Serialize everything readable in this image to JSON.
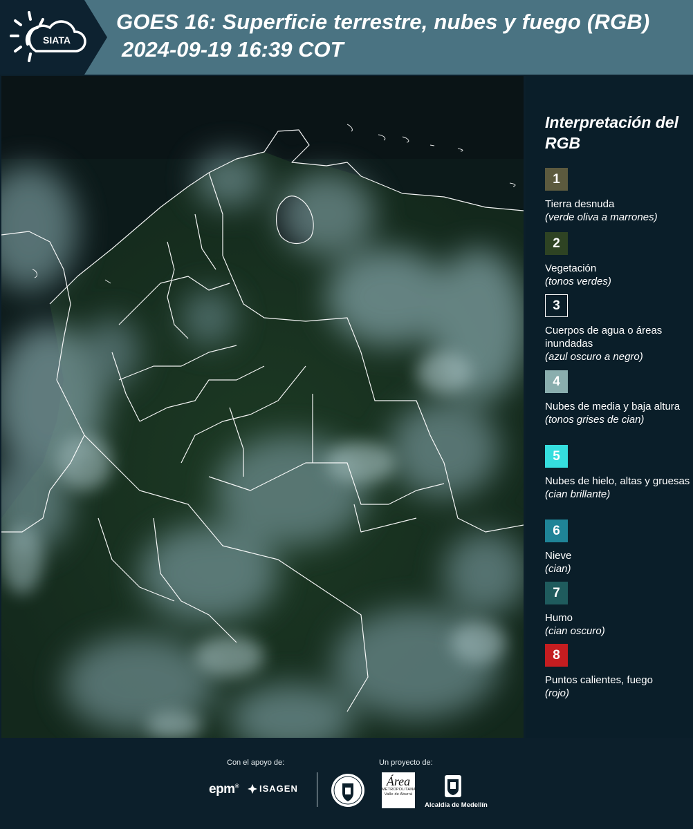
{
  "header": {
    "logo_text": "SIATA",
    "title": "GOES 16: Superficie terrestre, nubes y fuego (RGB)",
    "datetime": "2024-09-19 16:39 COT"
  },
  "map": {
    "icon": "satellite-rgb-map"
  },
  "legend": {
    "title": "Interpretación del RGB",
    "items": [
      {
        "number": "1",
        "label": "Tierra desnuda",
        "note": "(verde oliva a marrones)",
        "color": "#5c5a3e",
        "border": "#5c5a3e"
      },
      {
        "number": "2",
        "label": "Vegetación",
        "note": "(tonos verdes)",
        "color": "#2e4323",
        "border": "#2e4323"
      },
      {
        "number": "3",
        "label": "Cuerpos de agua o áreas inundadas",
        "note": "(azul oscuro a negro)",
        "color": "#0a1e29",
        "border": "#ffffff"
      },
      {
        "number": "4",
        "label": "Nubes de media y baja altura",
        "note": "(tonos grises de cian)",
        "color": "#8aaeae",
        "border": "#8aaeae"
      },
      {
        "number": "5",
        "label": "Nubes de hielo, altas y gruesas",
        "note": "(cian brillante)",
        "color": "#35dede",
        "border": "#35dede"
      },
      {
        "number": "6",
        "label": "Nieve",
        "note": "(cian)",
        "color": "#1f8497",
        "border": "#1f8497"
      },
      {
        "number": "7",
        "label": "Humo",
        "note": "(cian oscuro)",
        "color": "#1f5b5d",
        "border": "#1f5b5d"
      },
      {
        "number": "8",
        "label": "Puntos calientes, fuego",
        "note": "(rojo)",
        "color": "#c51d20",
        "border": "#c51d20"
      }
    ]
  },
  "footer": {
    "support_label": "Con el apoyo de:",
    "project_label": "Un proyecto de:",
    "epm": "epm",
    "epm_mark": "®",
    "isagen": "ISAGEN",
    "area_line1": "Área",
    "area_line2": "METROPOLITANA",
    "area_line3": "Valle de Aburrá",
    "alcaldia": "Alcaldía de Medellín"
  }
}
